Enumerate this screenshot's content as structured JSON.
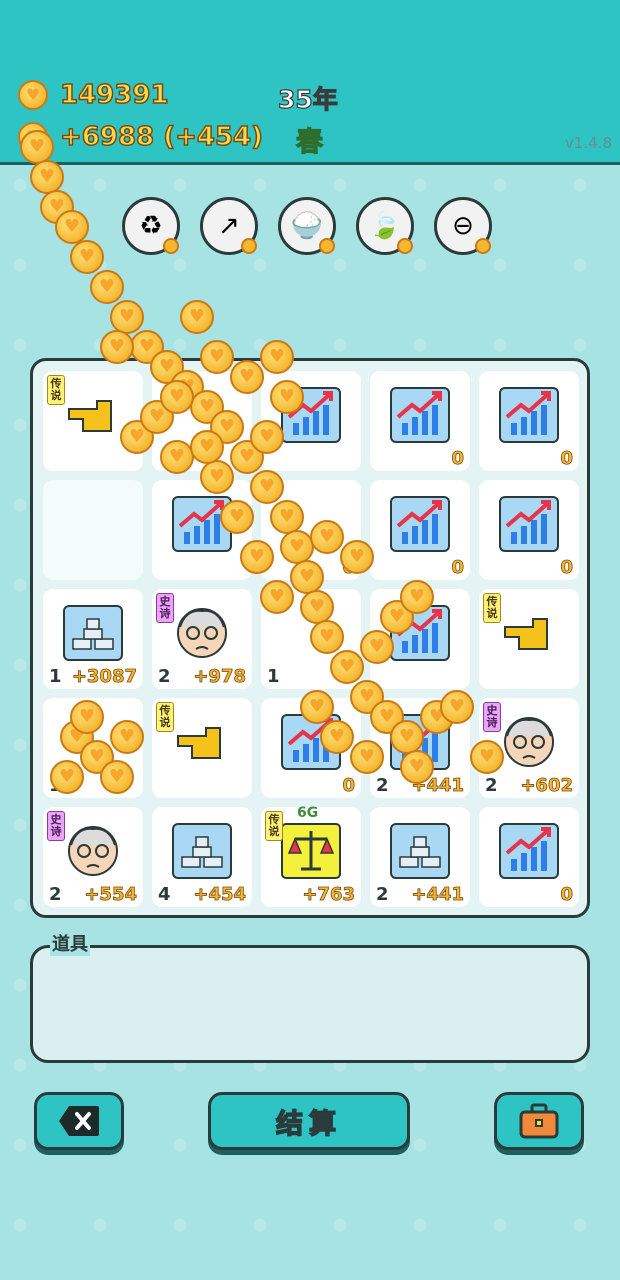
{
  "header": {
    "coins": "149391",
    "income": "+6988 (+454)",
    "year": "35年",
    "season": "春",
    "version": "v1.4.8"
  },
  "toolbar": [
    {
      "name": "refresh-icon",
      "glyph": "♻"
    },
    {
      "name": "arrow-up-icon",
      "glyph": "↗"
    },
    {
      "name": "rice-bowl-icon",
      "glyph": "🍚"
    },
    {
      "name": "leaf-icon",
      "glyph": "🍃"
    },
    {
      "name": "minus-icon",
      "glyph": "⊖"
    }
  ],
  "board": {
    "cells": [
      {
        "type": "pointer",
        "tag": "传说",
        "tag_kind": "legend",
        "count": "",
        "value": ""
      },
      {
        "type": "coin-hidden",
        "tag": "",
        "count": "",
        "value": ""
      },
      {
        "type": "chart",
        "tag": "",
        "count": "",
        "value": ""
      },
      {
        "type": "chart",
        "tag": "",
        "count": "",
        "value": "0"
      },
      {
        "type": "chart",
        "tag": "",
        "count": "",
        "value": "0"
      },
      {
        "type": "empty",
        "tag": "",
        "count": "",
        "value": ""
      },
      {
        "type": "chart",
        "tag": "",
        "count": "",
        "value": ""
      },
      {
        "type": "coin-hidden",
        "tag": "",
        "count": "",
        "value": "0"
      },
      {
        "type": "chart",
        "tag": "",
        "count": "",
        "value": "0"
      },
      {
        "type": "chart",
        "tag": "",
        "count": "",
        "value": "0"
      },
      {
        "type": "gold",
        "tag": "",
        "count": "1",
        "value": "+3087"
      },
      {
        "type": "grandpa",
        "tag": "史诗",
        "tag_kind": "epic",
        "count": "2",
        "value": "+978"
      },
      {
        "type": "coin-hidden",
        "tag": "",
        "count": "1",
        "value": ""
      },
      {
        "type": "chart",
        "tag": "",
        "count": "",
        "value": ""
      },
      {
        "type": "pointer",
        "tag": "传说",
        "tag_kind": "legend",
        "count": "",
        "value": ""
      },
      {
        "type": "coin-hidden",
        "tag": "",
        "count": "1",
        "value": ""
      },
      {
        "type": "pointer",
        "tag": "传说",
        "tag_kind": "legend",
        "count": "",
        "value": ""
      },
      {
        "type": "chart",
        "tag": "",
        "count": "",
        "value": "0"
      },
      {
        "type": "chart",
        "tag": "",
        "count": "2",
        "value": "+441"
      },
      {
        "type": "grandpa",
        "tag": "史诗",
        "tag_kind": "epic",
        "count": "2",
        "value": "+602"
      },
      {
        "type": "grandpa",
        "tag": "史诗",
        "tag_kind": "epic",
        "count": "2",
        "value": "+554"
      },
      {
        "type": "gold",
        "tag": "",
        "count": "4",
        "value": "+454"
      },
      {
        "type": "scale",
        "tag": "传说",
        "tag_kind": "legend",
        "super": "6G",
        "count": "",
        "value": "+763"
      },
      {
        "type": "gold",
        "tag": "",
        "count": "2",
        "value": "+441"
      },
      {
        "type": "chart",
        "tag": "",
        "count": "",
        "value": "0"
      }
    ]
  },
  "items": {
    "label": "道具"
  },
  "buttons": {
    "settle": "结算"
  },
  "colors": {
    "teal": "#2ec4c4",
    "background": "#a8e3e3",
    "coin": "#f5b731",
    "chart_bar": "#2e7ee8",
    "chart_arrow": "#e8344a"
  }
}
